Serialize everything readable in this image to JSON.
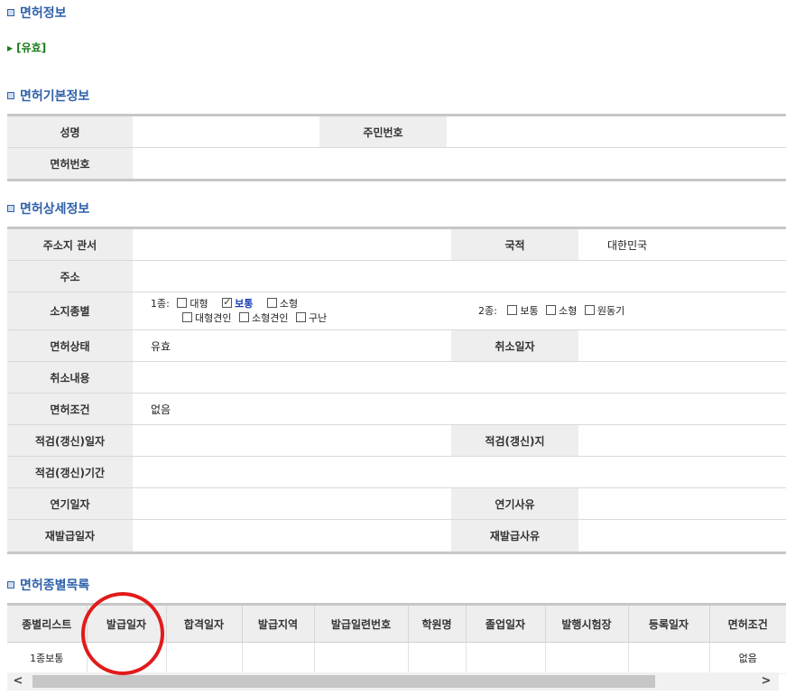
{
  "sections": {
    "license_info": "면허정보",
    "basic_info": "면허기본정보",
    "detail_info": "면허상세정보",
    "type_list": "면허종별목록"
  },
  "status": "[유효]",
  "basic": {
    "name_label": "성명",
    "name_value": "",
    "rrn_label": "주민번호",
    "rrn_value": "",
    "license_no_label": "면허번호",
    "license_no_value": ""
  },
  "detail": {
    "jurisdiction_label": "주소지 관서",
    "jurisdiction_value": "",
    "nationality_label": "국적",
    "nationality_value": "대한민국",
    "address_label": "주소",
    "address_value": "",
    "types_label": "소지종별",
    "class1_prefix": "1종:",
    "class1_large": "대형",
    "class1_normal": "보통",
    "class1_small": "소형",
    "class1_trailer": "대형견인",
    "class1_smalltow": "소형견인",
    "class1_wrecker": "구난",
    "class2_prefix": "2종:",
    "class2_normal": "보통",
    "class2_small": "소형",
    "class2_moped": "원동기",
    "state_label": "면허상태",
    "state_value": "유효",
    "cancel_date_label": "취소일자",
    "cancel_date_value": "",
    "cancel_content_label": "취소내용",
    "cancel_content_value": "",
    "condition_label": "면허조건",
    "condition_value": "없음",
    "aptitude_date_label": "적검(갱신)일자",
    "aptitude_date_value": "",
    "aptitude_place_label": "적검(갱신)지",
    "aptitude_place_value": "",
    "aptitude_period_label": "적검(갱신)기간",
    "aptitude_period_value": "",
    "postpone_date_label": "연기일자",
    "postpone_date_value": "",
    "postpone_reason_label": "연기사유",
    "postpone_reason_value": "",
    "reissue_date_label": "재발급일자",
    "reissue_date_value": "",
    "reissue_reason_label": "재발급사유",
    "reissue_reason_value": ""
  },
  "list": {
    "headers": [
      "종별리스트",
      "발급일자",
      "합격일자",
      "발급지역",
      "발급일련번호",
      "학원명",
      "졸업일자",
      "발행시험장",
      "등록일자",
      "면허조건"
    ],
    "row": [
      "1종보통",
      "",
      "",
      "",
      "",
      "",
      "",
      "",
      "",
      "없음"
    ]
  },
  "scroll": {
    "left": "<",
    "right": ">"
  }
}
